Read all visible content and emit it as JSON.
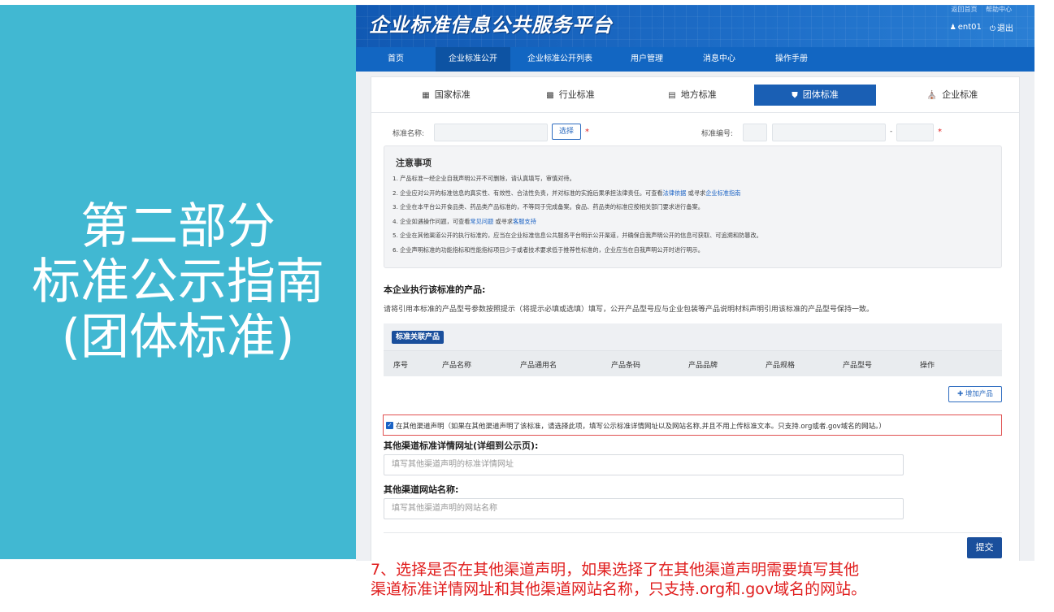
{
  "left": {
    "line1": "第二部分",
    "line2": "标准公示指南",
    "line3": "(团体标准)"
  },
  "header": {
    "site_title": "企业标准信息公共服务平台",
    "links": [
      "返回首页",
      "帮助中心"
    ],
    "user": "ent01",
    "logout": "退出"
  },
  "nav": [
    "首页",
    "企业标准公开",
    "企业标准公开列表",
    "用户管理",
    "消息中心",
    "操作手册"
  ],
  "tabs": [
    "国家标准",
    "行业标准",
    "地方标准",
    "团体标准",
    "企业标准"
  ],
  "form": {
    "std_name_label": "标准名称:",
    "select_button": "选择",
    "std_no_label": "标准编号:",
    "dash": "-",
    "req": "*"
  },
  "notice": {
    "title": "注意事项",
    "items": [
      {
        "text": "1. 产品标准一经企业自我声明公开不可删除，请认真填写，审慎对待。"
      },
      {
        "pre": "2. 企业应对公开的标准信息的真实性、有效性、合法性负责，并对标准的实施后果承担法律责任。可查看",
        "link1": "法律依据",
        "mid": " 或寻求",
        "link2": "企业标准指南"
      },
      {
        "text": "3. 企业在本平台公开食品类、药品类产品标准的，不等同于完成备案。食品、药品类的标准应按相关部门要求进行备案。"
      },
      {
        "pre": "4. 企业如遇操作问题，可查看",
        "link1": "常见问题",
        "mid": " 或寻求",
        "link2": "客服支持"
      },
      {
        "text": "5. 企业在其他渠道公开的执行标准的，应当在企业标准信息公共服务平台明示公开渠道，并确保自我声明公开的信息可获取、可追溯和防篡改。"
      },
      {
        "text": "6. 企业声明标准的功能指标和性能指标项目少于或者技术要求低于推荐性标准的，企业应当在自我声明公开时进行明示。"
      }
    ]
  },
  "products": {
    "title": "本企业执行该标准的产品:",
    "desc": "请将引用本标准的产品型号参数按照提示（将提示必填或选填）填写，公开产品型号应与企业包装等产品说明材料声明引用该标准的产品型号保持一致。",
    "tag": "标准关联产品",
    "columns": [
      "序号",
      "产品名称",
      "产品通用名",
      "产品条码",
      "产品品牌",
      "产品规格",
      "产品型号",
      "操作"
    ],
    "add_button": "增加产品"
  },
  "other": {
    "checked": true,
    "decl_text": "在其他渠道声明（如果在其他渠道声明了该标准，请选择此项，填写公示标准详情网址以及网站名称,并且不用上传标准文本。只支持.org或者.gov域名的网站。）",
    "url_label": "其他渠道标准详情网址(详细到公示页):",
    "url_placeholder": "填写其他渠道声明的标准详情网址",
    "site_label": "其他渠道网站名称:",
    "site_placeholder": "填写其他渠道声明的网站名称",
    "submit": "提交"
  },
  "caption": {
    "line1": "7、选择是否在其他渠道声明，如果选择了在其他渠道声明需要填写其他",
    "line2": "渠道标准详情网址和其他渠道网站名称，只支持.org和.gov域名的网站。"
  },
  "colors": {
    "teal": "#41b8d2",
    "brand_blue": "#1266c2",
    "active_tab": "#1a5fb4",
    "caption_red": "#e01e1e"
  }
}
